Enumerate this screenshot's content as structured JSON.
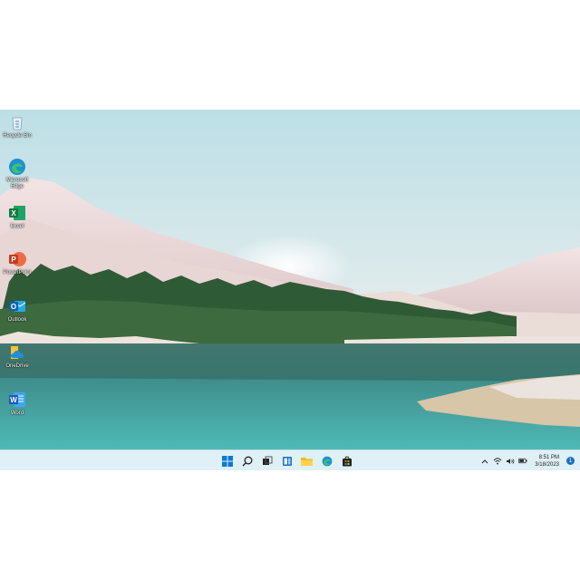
{
  "desktop": {
    "icons": [
      {
        "label": "Recycle Bin",
        "icon": "recycle-bin-icon"
      },
      {
        "label": "Microsoft Edge",
        "icon": "edge-icon"
      },
      {
        "label": "Excel",
        "icon": "excel-icon"
      },
      {
        "label": "PowerPoint",
        "icon": "powerpoint-icon"
      },
      {
        "label": "Outlook",
        "icon": "outlook-icon"
      },
      {
        "label": "OneDrive",
        "icon": "onedrive-icon"
      },
      {
        "label": "Word",
        "icon": "word-icon"
      }
    ]
  },
  "taskbar": {
    "apps": [
      "start-icon",
      "search-icon",
      "task-view-icon",
      "widgets-icon",
      "file-explorer-icon",
      "edge-icon",
      "store-icon"
    ],
    "tray": {
      "icons": [
        "chevron-up-icon",
        "wifi-icon",
        "volume-icon",
        "battery-icon"
      ],
      "time": "8:51 PM",
      "date": "3/18/2023",
      "notification_count": "1"
    }
  },
  "colors": {
    "taskbar_bg": "#dff0f6",
    "accent": "#1d6fc2"
  }
}
